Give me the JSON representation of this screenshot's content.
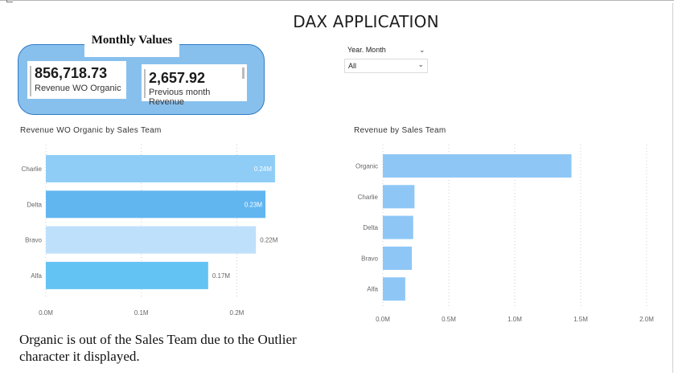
{
  "page": {
    "title": "DAX APPLICATION",
    "note": "Organic is out of the Sales Team due to the Outlier character it displayed."
  },
  "kpi_panel": {
    "title": "Monthly Values",
    "background": "#88c0ed",
    "border_color": "#2e7bc4",
    "cards": [
      {
        "value": "856,718.73",
        "label": "Revenue WO Organic"
      },
      {
        "value": "2,657.92",
        "label": "Previous month Revenue"
      }
    ]
  },
  "slicer": {
    "title": "Year. Month",
    "selected": "All",
    "icon": "chevron-down-icon"
  },
  "chart_data": [
    {
      "type": "bar",
      "orientation": "horizontal",
      "title": "Revenue WO Organic by Sales Team",
      "categories": [
        "Charlie",
        "Delta",
        "Bravo",
        "Alfa"
      ],
      "values": [
        240000,
        230000,
        220000,
        170000
      ],
      "data_labels": [
        "0.24M",
        "0.23M",
        "0.22M",
        "0.17M"
      ],
      "colors": [
        "#8fcdf6",
        "#62b6f0",
        "#bfe0fb",
        "#63c3f3"
      ],
      "x_ticks": [
        "0.0M",
        "0.1M",
        "0.2M"
      ],
      "x_tick_values": [
        0,
        100000,
        200000
      ],
      "xlim": [
        0,
        235000
      ],
      "grid": "vertical dotted"
    },
    {
      "type": "bar",
      "orientation": "horizontal",
      "title": "Revenue by Sales Team",
      "categories": [
        "Organic",
        "Charlie",
        "Delta",
        "Bravo",
        "Alfa"
      ],
      "values": [
        1430000,
        240000,
        230000,
        220000,
        170000
      ],
      "color": "#8ec7f6",
      "x_ticks": [
        "0.0M",
        "0.5M",
        "1.0M",
        "1.5M",
        "2.0M"
      ],
      "x_tick_values": [
        0,
        500000,
        1000000,
        1500000,
        2000000
      ],
      "xlim": [
        0,
        2000000
      ],
      "grid": "vertical dotted"
    }
  ]
}
